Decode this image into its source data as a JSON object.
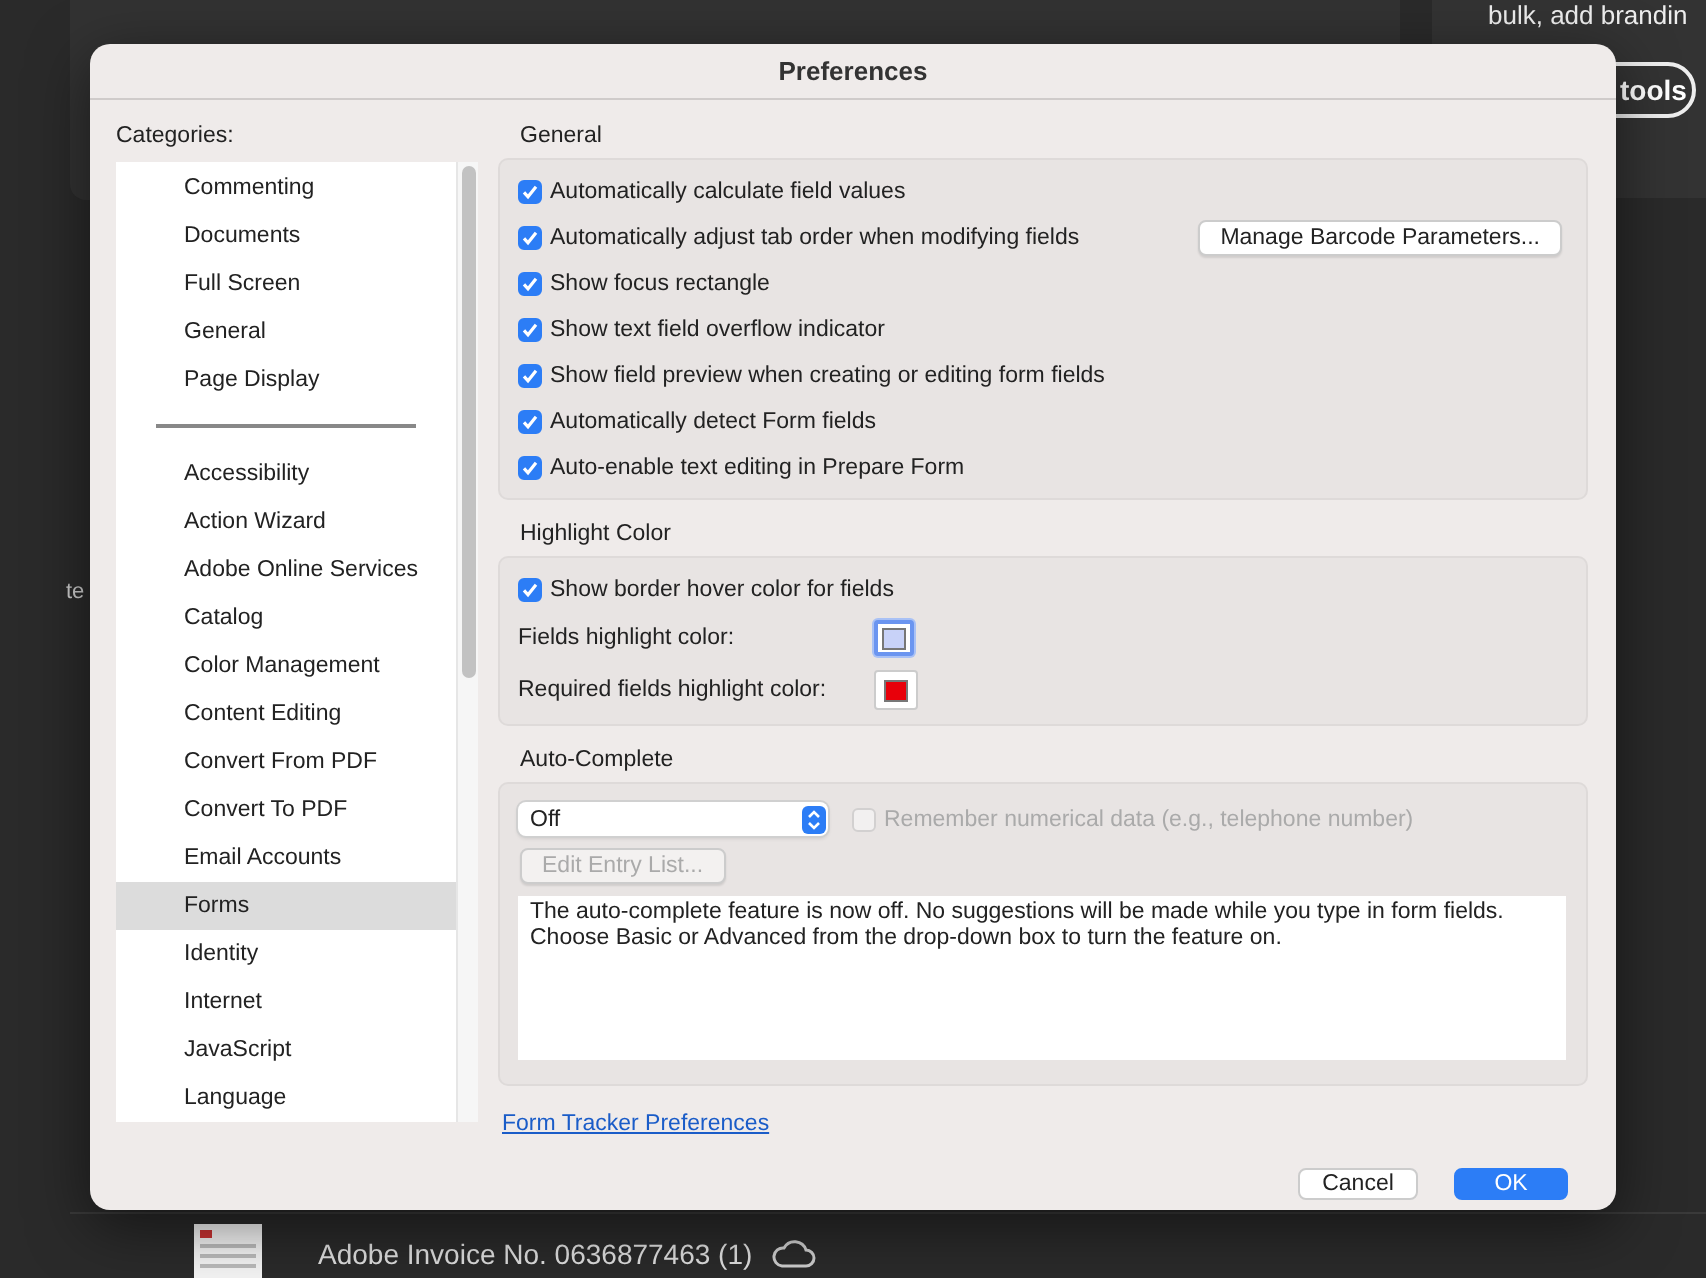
{
  "backdrop": {
    "side_text": "bulk, add brandin",
    "side_button": "tools",
    "left_texts": [
      "te"
    ],
    "file_row": {
      "name": "Adobe Invoice No. 0636877463 (1)"
    }
  },
  "dialog": {
    "title": "Preferences",
    "categories_label": "Categories:",
    "category_groups": [
      [
        {
          "label": "Commenting",
          "selected": false
        },
        {
          "label": "Documents",
          "selected": false
        },
        {
          "label": "Full Screen",
          "selected": false
        },
        {
          "label": "General",
          "selected": false
        },
        {
          "label": "Page Display",
          "selected": false
        }
      ],
      [
        {
          "label": "Accessibility",
          "selected": false
        },
        {
          "label": "Action Wizard",
          "selected": false
        },
        {
          "label": "Adobe Online Services",
          "selected": false
        },
        {
          "label": "Catalog",
          "selected": false
        },
        {
          "label": "Color Management",
          "selected": false
        },
        {
          "label": "Content Editing",
          "selected": false
        },
        {
          "label": "Convert From PDF",
          "selected": false
        },
        {
          "label": "Convert To PDF",
          "selected": false
        },
        {
          "label": "Email Accounts",
          "selected": false
        },
        {
          "label": "Forms",
          "selected": true
        },
        {
          "label": "Identity",
          "selected": false
        },
        {
          "label": "Internet",
          "selected": false
        },
        {
          "label": "JavaScript",
          "selected": false
        },
        {
          "label": "Language",
          "selected": false
        }
      ]
    ],
    "general": {
      "heading": "General",
      "items": [
        {
          "label": "Automatically calculate field values",
          "checked": true
        },
        {
          "label": "Automatically adjust tab order when modifying fields",
          "checked": true,
          "button": "Manage Barcode Parameters..."
        },
        {
          "label": "Show focus rectangle",
          "checked": true
        },
        {
          "label": "Show text field overflow indicator",
          "checked": true
        },
        {
          "label": "Show field preview when creating or editing form fields",
          "checked": true
        },
        {
          "label": "Automatically detect Form fields",
          "checked": true
        },
        {
          "label": "Auto-enable text editing in Prepare Form",
          "checked": true
        }
      ]
    },
    "highlight": {
      "heading": "Highlight Color",
      "items": [
        {
          "kind": "checkbox",
          "label": "Show border hover color for fields",
          "checked": true
        },
        {
          "kind": "color",
          "label": "Fields highlight color:",
          "color": "#c8d2f8",
          "focused": true
        },
        {
          "kind": "color",
          "label": "Required fields highlight color:",
          "color": "#e8000a",
          "focused": false
        }
      ]
    },
    "autocomplete": {
      "heading": "Auto-Complete",
      "select": "Off",
      "remember": {
        "label": "Remember numerical data (e.g., telephone number)",
        "checked": false,
        "disabled": true
      },
      "edit_button": {
        "label": "Edit Entry List...",
        "disabled": true
      },
      "description": "The auto-complete feature is now off. No suggestions will be made while you type in form fields. Choose Basic or Advanced from the drop-down box to turn the feature on."
    },
    "link": "Form Tracker Preferences",
    "buttons": [
      {
        "label": "Cancel",
        "default": false
      },
      {
        "label": "OK",
        "default": true
      }
    ]
  }
}
